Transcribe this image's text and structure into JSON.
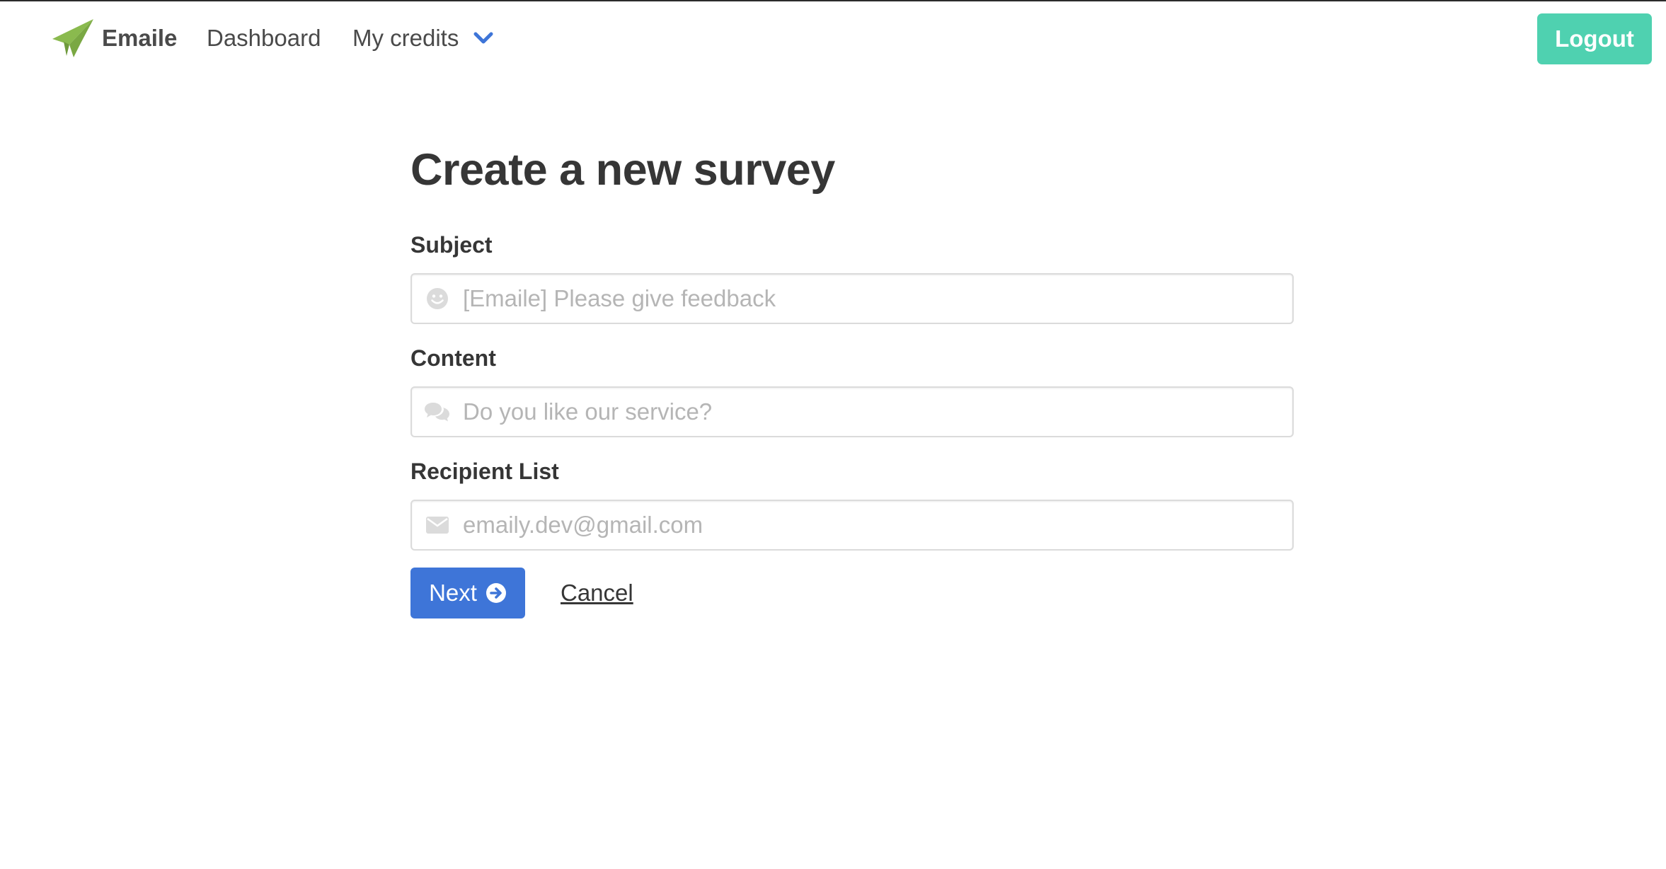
{
  "navbar": {
    "brand_name": "Emaile",
    "brand_icon": "paper-plane-icon",
    "dashboard_label": "Dashboard",
    "credits_label": "My credits",
    "credits_icon": "chevron-down-icon",
    "logout_label": "Logout"
  },
  "form": {
    "title": "Create a new survey",
    "subject": {
      "label": "Subject",
      "placeholder": "[Emaile] Please give feedback",
      "value": "",
      "icon": "smile-icon"
    },
    "content": {
      "label": "Content",
      "placeholder": "Do you like our service?",
      "value": "",
      "icon": "comments-icon"
    },
    "recipients": {
      "label": "Recipient List",
      "placeholder": "emaily.dev@gmail.com",
      "value": "",
      "icon": "envelope-icon"
    },
    "next_label": "Next",
    "next_icon": "arrow-circle-right-icon",
    "cancel_label": "Cancel"
  },
  "colors": {
    "brand_green": "#8aba4e",
    "logout_teal": "#4fd1b0",
    "primary_blue": "#3e75d8",
    "chevron_blue": "#3e75d8",
    "text_dark": "#363636",
    "placeholder_gray": "#b5b5b5"
  }
}
